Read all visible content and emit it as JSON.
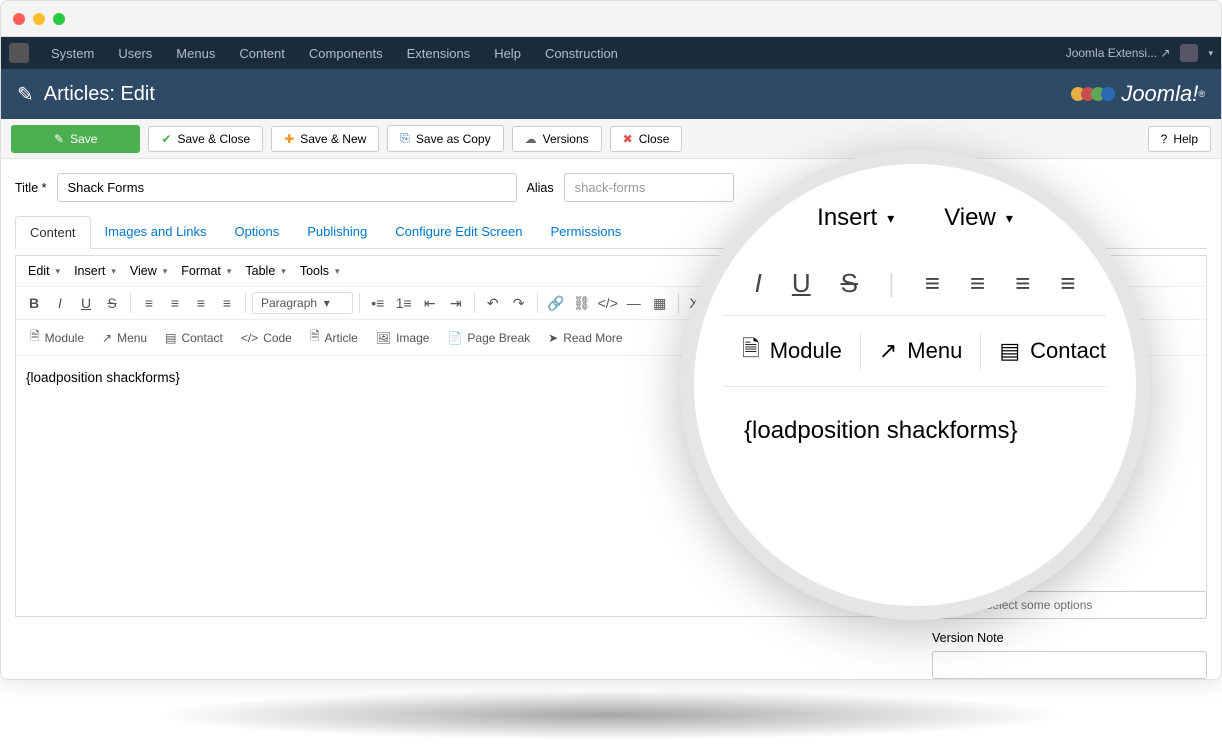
{
  "menubar": {
    "items": [
      "System",
      "Users",
      "Menus",
      "Content",
      "Components",
      "Extensions",
      "Help",
      "Construction"
    ],
    "right_link": "Joomla Extensi..."
  },
  "header": {
    "title": "Articles: Edit",
    "brand": "Joomla!"
  },
  "toolbar": {
    "save": "Save",
    "save_close": "Save & Close",
    "save_new": "Save & New",
    "save_copy": "Save as Copy",
    "versions": "Versions",
    "close": "Close",
    "help": "Help"
  },
  "fields": {
    "title_label": "Title *",
    "title_value": "Shack Forms",
    "alias_label": "Alias",
    "alias_value": "shack-forms"
  },
  "tabs": [
    "Content",
    "Images and Links",
    "Options",
    "Publishing",
    "Configure Edit Screen",
    "Permissions"
  ],
  "editor": {
    "menus": [
      "Edit",
      "Insert",
      "View",
      "Format",
      "Table",
      "Tools"
    ],
    "paragraph": "Paragraph",
    "insert_buttons": [
      "Module",
      "Menu",
      "Contact",
      "Code",
      "Article",
      "Image",
      "Page Break",
      "Read More"
    ],
    "content": "{loadposition shackforms}"
  },
  "side": {
    "tags_placeholder": "Type or select some options",
    "version_note_label": "Version Note"
  },
  "magnifier": {
    "menu1": "Insert",
    "menu2": "View",
    "btn1": "Module",
    "btn2": "Menu",
    "btn3": "Contact",
    "content": "{loadposition shackforms}"
  }
}
